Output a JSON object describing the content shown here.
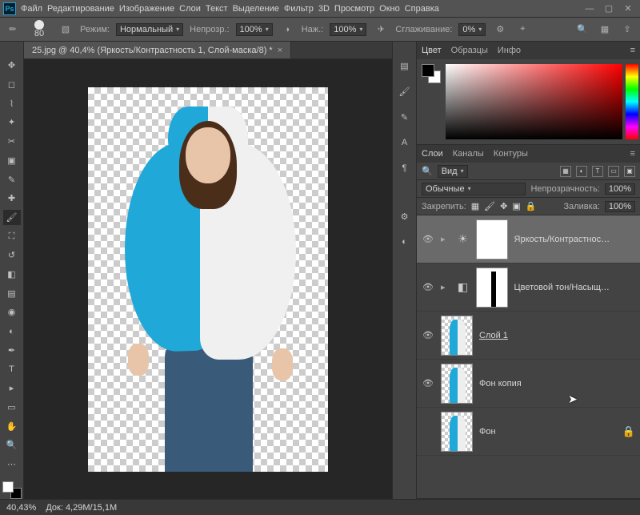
{
  "menu": {
    "items": [
      "Файл",
      "Редактирование",
      "Изображение",
      "Слои",
      "Текст",
      "Выделение",
      "Фильтр",
      "3D",
      "Просмотр",
      "Окно",
      "Справка"
    ]
  },
  "optbar": {
    "brush_size": "80",
    "mode_label": "Режим:",
    "mode_value": "Нормальный",
    "opacity_label": "Непрозр.:",
    "opacity_value": "100%",
    "flow_label": "Наж.:",
    "flow_value": "100%",
    "smooth_label": "Сглаживание:",
    "smooth_value": "0%"
  },
  "doc": {
    "tab_title": "25.jpg @ 40,4% (Яркость/Контрастность 1, Слой-маска/8) *"
  },
  "panels": {
    "color": {
      "tabs": [
        "Цвет",
        "Образцы",
        "Инфо"
      ]
    },
    "layers": {
      "tabs": [
        "Слои",
        "Каналы",
        "Контуры"
      ],
      "kind_label": "Вид",
      "blend_value": "Обычные",
      "opacity_label": "Непрозрачность:",
      "opacity_value": "100%",
      "fill_label": "Заливка:",
      "fill_value": "100%",
      "lock_label": "Закрепить:"
    }
  },
  "layers": [
    {
      "name": "Яркость/Контрастнос…",
      "visible": true,
      "selected": true,
      "type": "adj",
      "adj_icon": "☀",
      "mask": "white"
    },
    {
      "name": "Цветовой тон/Насыщ…",
      "visible": true,
      "selected": false,
      "type": "adj",
      "adj_icon": "◧",
      "mask": "fig"
    },
    {
      "name": "Слой 1",
      "visible": true,
      "selected": false,
      "type": "pixel",
      "underline": true
    },
    {
      "name": "Фон копия",
      "visible": true,
      "selected": false,
      "type": "pixel"
    },
    {
      "name": "Фон",
      "visible": false,
      "selected": false,
      "type": "pixel",
      "locked": true
    }
  ],
  "status": {
    "zoom": "40,43%",
    "doc_label": "Док:",
    "doc_size": "4,29M/15,1M"
  }
}
